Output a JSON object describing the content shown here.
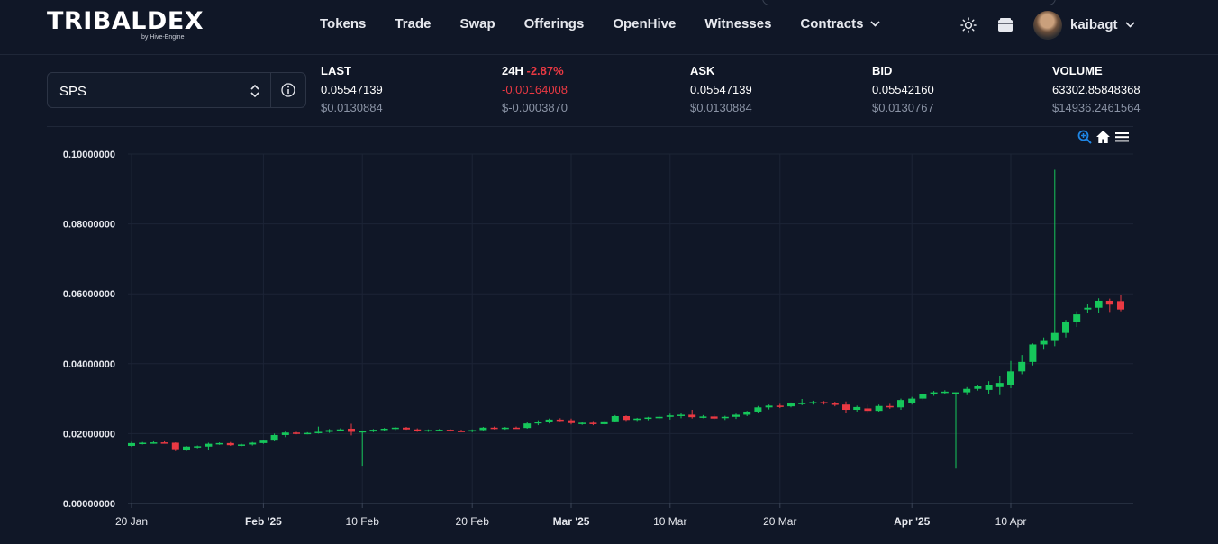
{
  "header": {
    "logo": "TRIBALDEX",
    "logo_sub": "by Hive-Engine",
    "nav": [
      "Tokens",
      "Trade",
      "Swap",
      "Offerings",
      "OpenHive",
      "Witnesses",
      "Contracts"
    ],
    "username": "kaibagt"
  },
  "token_select": {
    "value": "SPS"
  },
  "stats": {
    "last": {
      "label": "LAST",
      "value": "0.05547139",
      "usd": "$0.0130884"
    },
    "change_24h": {
      "label": "24H",
      "change": "-2.87%",
      "value": "-0.00164008",
      "usd": "$-0.0003870"
    },
    "ask": {
      "label": "ASK",
      "value": "0.05547139",
      "usd": "$0.0130884"
    },
    "bid": {
      "label": "BID",
      "value": "0.05542160",
      "usd": "$0.0130767"
    },
    "volume": {
      "label": "VOLUME",
      "value": "63302.85848368",
      "usd": "$14936.2461564"
    }
  },
  "colors": {
    "up": "#16c75b",
    "down": "#ea3943",
    "grid": "#1c2436",
    "background": "#101727",
    "accent": "#1f86e5"
  },
  "chart_tools": {
    "zoom": "zoom-in-icon",
    "reset": "home-icon",
    "menu": "hamburger-menu-icon"
  },
  "chart_data": {
    "type": "candlestick",
    "x_type": "date",
    "x_range": [
      "2025-01-20",
      "2025-04-19"
    ],
    "ylim": [
      0,
      0.1
    ],
    "y_ticks": [
      "0.00000000",
      "0.02000000",
      "0.04000000",
      "0.06000000",
      "0.08000000",
      "0.10000000"
    ],
    "x_ticks": [
      {
        "date": "2025-01-20",
        "label": "20 Jan",
        "bold": false
      },
      {
        "date": "2025-02-01",
        "label": "Feb '25",
        "bold": true
      },
      {
        "date": "2025-02-10",
        "label": "10 Feb",
        "bold": false
      },
      {
        "date": "2025-02-20",
        "label": "20 Feb",
        "bold": false
      },
      {
        "date": "2025-03-01",
        "label": "Mar '25",
        "bold": true
      },
      {
        "date": "2025-03-10",
        "label": "10 Mar",
        "bold": false
      },
      {
        "date": "2025-03-20",
        "label": "20 Mar",
        "bold": false
      },
      {
        "date": "2025-04-01",
        "label": "Apr '25",
        "bold": true
      },
      {
        "date": "2025-04-10",
        "label": "10 Apr",
        "bold": false
      }
    ],
    "grid": true,
    "candles": [
      {
        "date": "2025-01-20",
        "o": 0.0165,
        "h": 0.0177,
        "l": 0.0162,
        "c": 0.0173
      },
      {
        "date": "2025-01-21",
        "o": 0.0172,
        "h": 0.0176,
        "l": 0.0169,
        "c": 0.0174
      },
      {
        "date": "2025-01-22",
        "o": 0.0174,
        "h": 0.0178,
        "l": 0.0171,
        "c": 0.0175
      },
      {
        "date": "2025-01-23",
        "o": 0.0175,
        "h": 0.0178,
        "l": 0.0172,
        "c": 0.0174
      },
      {
        "date": "2025-01-24",
        "o": 0.0174,
        "h": 0.0175,
        "l": 0.015,
        "c": 0.0153
      },
      {
        "date": "2025-01-25",
        "o": 0.0152,
        "h": 0.0165,
        "l": 0.015,
        "c": 0.0163
      },
      {
        "date": "2025-01-26",
        "o": 0.0163,
        "h": 0.0166,
        "l": 0.0158,
        "c": 0.0164
      },
      {
        "date": "2025-01-27",
        "o": 0.0163,
        "h": 0.0174,
        "l": 0.0152,
        "c": 0.0171
      },
      {
        "date": "2025-01-28",
        "o": 0.0171,
        "h": 0.0175,
        "l": 0.0168,
        "c": 0.0173
      },
      {
        "date": "2025-01-29",
        "o": 0.0173,
        "h": 0.0176,
        "l": 0.0165,
        "c": 0.0167
      },
      {
        "date": "2025-01-30",
        "o": 0.0167,
        "h": 0.0171,
        "l": 0.0164,
        "c": 0.0169
      },
      {
        "date": "2025-01-31",
        "o": 0.0169,
        "h": 0.0176,
        "l": 0.0166,
        "c": 0.0174
      },
      {
        "date": "2025-02-01",
        "o": 0.0173,
        "h": 0.0183,
        "l": 0.0171,
        "c": 0.018
      },
      {
        "date": "2025-02-02",
        "o": 0.018,
        "h": 0.02,
        "l": 0.0178,
        "c": 0.0196
      },
      {
        "date": "2025-02-03",
        "o": 0.0196,
        "h": 0.0206,
        "l": 0.019,
        "c": 0.0203
      },
      {
        "date": "2025-02-04",
        "o": 0.0203,
        "h": 0.0205,
        "l": 0.0198,
        "c": 0.02
      },
      {
        "date": "2025-02-05",
        "o": 0.0201,
        "h": 0.0204,
        "l": 0.0198,
        "c": 0.0202
      },
      {
        "date": "2025-02-06",
        "o": 0.0203,
        "h": 0.022,
        "l": 0.02,
        "c": 0.0205
      },
      {
        "date": "2025-02-07",
        "o": 0.0205,
        "h": 0.0213,
        "l": 0.0202,
        "c": 0.021
      },
      {
        "date": "2025-02-08",
        "o": 0.021,
        "h": 0.0215,
        "l": 0.0207,
        "c": 0.0212
      },
      {
        "date": "2025-02-09",
        "o": 0.0214,
        "h": 0.0228,
        "l": 0.0195,
        "c": 0.0205
      },
      {
        "date": "2025-02-10",
        "o": 0.0205,
        "h": 0.0209,
        "l": 0.0108,
        "c": 0.0207
      },
      {
        "date": "2025-02-11",
        "o": 0.0206,
        "h": 0.0213,
        "l": 0.0204,
        "c": 0.0211
      },
      {
        "date": "2025-02-12",
        "o": 0.0211,
        "h": 0.0216,
        "l": 0.0208,
        "c": 0.0214
      },
      {
        "date": "2025-02-13",
        "o": 0.0214,
        "h": 0.0219,
        "l": 0.021,
        "c": 0.0217
      },
      {
        "date": "2025-02-14",
        "o": 0.0217,
        "h": 0.0219,
        "l": 0.0211,
        "c": 0.0212
      },
      {
        "date": "2025-02-15",
        "o": 0.0212,
        "h": 0.0215,
        "l": 0.0205,
        "c": 0.0208
      },
      {
        "date": "2025-02-16",
        "o": 0.0208,
        "h": 0.0212,
        "l": 0.0205,
        "c": 0.021
      },
      {
        "date": "2025-02-17",
        "o": 0.021,
        "h": 0.0213,
        "l": 0.0207,
        "c": 0.0211
      },
      {
        "date": "2025-02-18",
        "o": 0.0211,
        "h": 0.0213,
        "l": 0.0206,
        "c": 0.0208
      },
      {
        "date": "2025-02-19",
        "o": 0.0208,
        "h": 0.0211,
        "l": 0.0205,
        "c": 0.0206
      },
      {
        "date": "2025-02-20",
        "o": 0.0206,
        "h": 0.0212,
        "l": 0.0204,
        "c": 0.021
      },
      {
        "date": "2025-02-21",
        "o": 0.021,
        "h": 0.0219,
        "l": 0.0209,
        "c": 0.0217
      },
      {
        "date": "2025-02-22",
        "o": 0.0217,
        "h": 0.022,
        "l": 0.0212,
        "c": 0.0214
      },
      {
        "date": "2025-02-23",
        "o": 0.0214,
        "h": 0.0219,
        "l": 0.0211,
        "c": 0.0217
      },
      {
        "date": "2025-02-24",
        "o": 0.0217,
        "h": 0.022,
        "l": 0.0214,
        "c": 0.0216
      },
      {
        "date": "2025-02-25",
        "o": 0.0216,
        "h": 0.0232,
        "l": 0.0214,
        "c": 0.0229
      },
      {
        "date": "2025-02-26",
        "o": 0.0229,
        "h": 0.0238,
        "l": 0.0224,
        "c": 0.0234
      },
      {
        "date": "2025-02-27",
        "o": 0.0234,
        "h": 0.0243,
        "l": 0.0229,
        "c": 0.024
      },
      {
        "date": "2025-02-28",
        "o": 0.024,
        "h": 0.0244,
        "l": 0.0235,
        "c": 0.0238
      },
      {
        "date": "2025-03-01",
        "o": 0.0238,
        "h": 0.0243,
        "l": 0.0226,
        "c": 0.023
      },
      {
        "date": "2025-03-02",
        "o": 0.023,
        "h": 0.0234,
        "l": 0.0225,
        "c": 0.0231
      },
      {
        "date": "2025-03-03",
        "o": 0.0231,
        "h": 0.0236,
        "l": 0.0224,
        "c": 0.0227
      },
      {
        "date": "2025-03-04",
        "o": 0.0227,
        "h": 0.0238,
        "l": 0.0225,
        "c": 0.0235
      },
      {
        "date": "2025-03-05",
        "o": 0.0235,
        "h": 0.0253,
        "l": 0.0233,
        "c": 0.025
      },
      {
        "date": "2025-03-06",
        "o": 0.025,
        "h": 0.0252,
        "l": 0.0236,
        "c": 0.0239
      },
      {
        "date": "2025-03-07",
        "o": 0.0239,
        "h": 0.0245,
        "l": 0.0236,
        "c": 0.0243
      },
      {
        "date": "2025-03-08",
        "o": 0.0243,
        "h": 0.0248,
        "l": 0.0238,
        "c": 0.0246
      },
      {
        "date": "2025-03-09",
        "o": 0.0244,
        "h": 0.0252,
        "l": 0.0241,
        "c": 0.0248
      },
      {
        "date": "2025-03-10",
        "o": 0.0248,
        "h": 0.0257,
        "l": 0.024,
        "c": 0.0252
      },
      {
        "date": "2025-03-11",
        "o": 0.0252,
        "h": 0.0259,
        "l": 0.0244,
        "c": 0.0254
      },
      {
        "date": "2025-03-12",
        "o": 0.0254,
        "h": 0.0268,
        "l": 0.0243,
        "c": 0.0247
      },
      {
        "date": "2025-03-13",
        "o": 0.0247,
        "h": 0.0253,
        "l": 0.0244,
        "c": 0.0249
      },
      {
        "date": "2025-03-14",
        "o": 0.0249,
        "h": 0.0255,
        "l": 0.024,
        "c": 0.0243
      },
      {
        "date": "2025-03-15",
        "o": 0.0245,
        "h": 0.0251,
        "l": 0.0239,
        "c": 0.0248
      },
      {
        "date": "2025-03-16",
        "o": 0.0248,
        "h": 0.0257,
        "l": 0.0242,
        "c": 0.0254
      },
      {
        "date": "2025-03-17",
        "o": 0.0254,
        "h": 0.0265,
        "l": 0.025,
        "c": 0.0263
      },
      {
        "date": "2025-03-18",
        "o": 0.0263,
        "h": 0.0279,
        "l": 0.0259,
        "c": 0.0275
      },
      {
        "date": "2025-03-19",
        "o": 0.0275,
        "h": 0.0283,
        "l": 0.0269,
        "c": 0.028
      },
      {
        "date": "2025-03-20",
        "o": 0.028,
        "h": 0.0285,
        "l": 0.0273,
        "c": 0.0278
      },
      {
        "date": "2025-03-21",
        "o": 0.0278,
        "h": 0.0289,
        "l": 0.0275,
        "c": 0.0286
      },
      {
        "date": "2025-03-22",
        "o": 0.0286,
        "h": 0.0299,
        "l": 0.0281,
        "c": 0.0288
      },
      {
        "date": "2025-03-23",
        "o": 0.0288,
        "h": 0.0294,
        "l": 0.0283,
        "c": 0.029
      },
      {
        "date": "2025-03-24",
        "o": 0.029,
        "h": 0.0293,
        "l": 0.0283,
        "c": 0.0286
      },
      {
        "date": "2025-03-25",
        "o": 0.0286,
        "h": 0.0291,
        "l": 0.0278,
        "c": 0.0283
      },
      {
        "date": "2025-03-26",
        "o": 0.0283,
        "h": 0.0292,
        "l": 0.0259,
        "c": 0.0268
      },
      {
        "date": "2025-03-27",
        "o": 0.0268,
        "h": 0.028,
        "l": 0.0263,
        "c": 0.0276
      },
      {
        "date": "2025-03-28",
        "o": 0.0272,
        "h": 0.0283,
        "l": 0.0257,
        "c": 0.0265
      },
      {
        "date": "2025-03-29",
        "o": 0.0265,
        "h": 0.0283,
        "l": 0.0263,
        "c": 0.0279
      },
      {
        "date": "2025-03-30",
        "o": 0.0279,
        "h": 0.0285,
        "l": 0.0271,
        "c": 0.0275
      },
      {
        "date": "2025-03-31",
        "o": 0.0275,
        "h": 0.03,
        "l": 0.0268,
        "c": 0.0296
      },
      {
        "date": "2025-04-01",
        "o": 0.0288,
        "h": 0.0305,
        "l": 0.0283,
        "c": 0.03
      },
      {
        "date": "2025-04-02",
        "o": 0.03,
        "h": 0.0315,
        "l": 0.0296,
        "c": 0.0312
      },
      {
        "date": "2025-04-03",
        "o": 0.0312,
        "h": 0.0322,
        "l": 0.0308,
        "c": 0.0318
      },
      {
        "date": "2025-04-04",
        "o": 0.0318,
        "h": 0.0324,
        "l": 0.0313,
        "c": 0.032
      },
      {
        "date": "2025-04-05",
        "o": 0.0316,
        "h": 0.0318,
        "l": 0.01,
        "c": 0.0318
      },
      {
        "date": "2025-04-06",
        "o": 0.0318,
        "h": 0.0333,
        "l": 0.031,
        "c": 0.0328
      },
      {
        "date": "2025-04-07",
        "o": 0.0328,
        "h": 0.0338,
        "l": 0.0323,
        "c": 0.0335
      },
      {
        "date": "2025-04-08",
        "o": 0.0325,
        "h": 0.035,
        "l": 0.0312,
        "c": 0.034
      },
      {
        "date": "2025-04-09",
        "o": 0.0333,
        "h": 0.0365,
        "l": 0.031,
        "c": 0.0345
      },
      {
        "date": "2025-04-10",
        "o": 0.034,
        "h": 0.0408,
        "l": 0.033,
        "c": 0.0378
      },
      {
        "date": "2025-04-11",
        "o": 0.0378,
        "h": 0.0425,
        "l": 0.037,
        "c": 0.0405
      },
      {
        "date": "2025-04-12",
        "o": 0.0405,
        "h": 0.0458,
        "l": 0.0395,
        "c": 0.0455
      },
      {
        "date": "2025-04-13",
        "o": 0.0455,
        "h": 0.0475,
        "l": 0.044,
        "c": 0.0465
      },
      {
        "date": "2025-04-14",
        "o": 0.0465,
        "h": 0.0955,
        "l": 0.045,
        "c": 0.0488
      },
      {
        "date": "2025-04-15",
        "o": 0.0488,
        "h": 0.0525,
        "l": 0.0475,
        "c": 0.052
      },
      {
        "date": "2025-04-16",
        "o": 0.052,
        "h": 0.055,
        "l": 0.0505,
        "c": 0.0541
      },
      {
        "date": "2025-04-17",
        "o": 0.0555,
        "h": 0.057,
        "l": 0.0545,
        "c": 0.056
      },
      {
        "date": "2025-04-18",
        "o": 0.056,
        "h": 0.0587,
        "l": 0.0545,
        "c": 0.058
      },
      {
        "date": "2025-04-19",
        "o": 0.058,
        "h": 0.0586,
        "l": 0.0548,
        "c": 0.0569
      },
      {
        "date": "2025-04-20",
        "o": 0.0579,
        "h": 0.0597,
        "l": 0.055,
        "c": 0.0555
      }
    ]
  }
}
